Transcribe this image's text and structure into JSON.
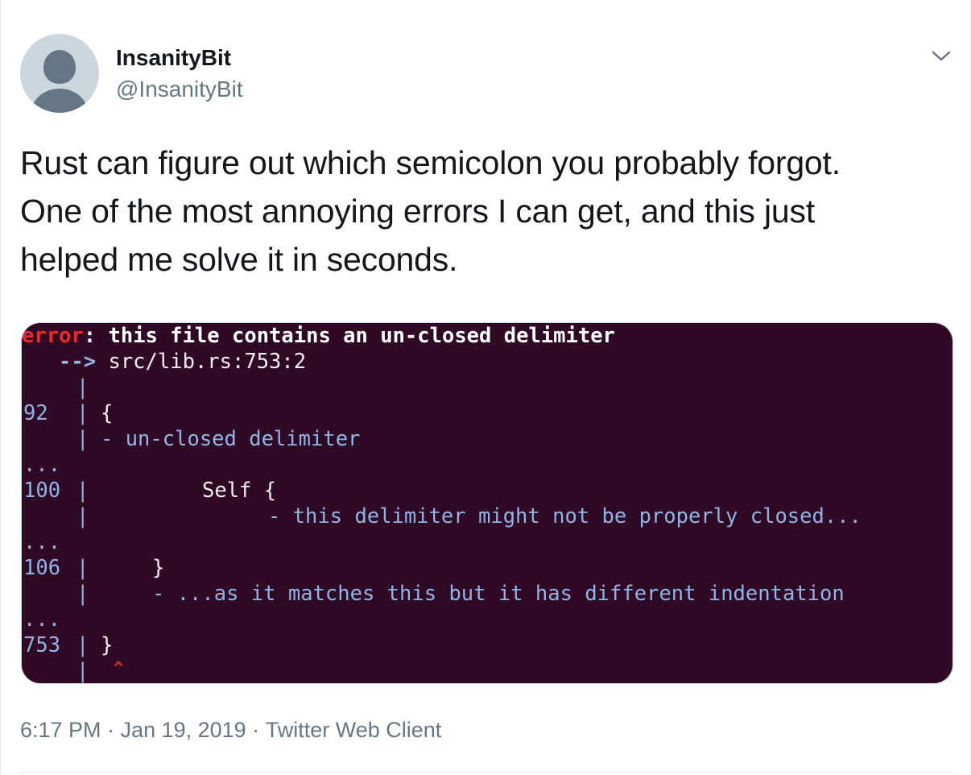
{
  "author": {
    "display_name": "InsanityBit",
    "handle": "@InsanityBit",
    "avatar_icon": "default-profile-icon"
  },
  "menu": {
    "caret_icon": "chevron-down-icon"
  },
  "tweet": {
    "lines": [
      "Rust can figure out which semicolon you probably forgot.",
      "One of the most annoying errors I can get, and this just",
      "helped me solve it in seconds."
    ]
  },
  "terminal": {
    "background": "#300a24",
    "error_color": "#ef2929",
    "note_color": "#8fb4e8",
    "error_label": "error",
    "error_message": ": this file contains an un-closed delimiter",
    "arrow": "   -->",
    "location": " src/lib.rs:753:2",
    "pipe": "|",
    "gutter_92": "92",
    "code_92": "{",
    "note_92": "- un-closed delimiter",
    "ellipsis": "...",
    "gutter_100": "100",
    "code_100": "Self {",
    "note_100": "- this delimiter might not be properly closed...",
    "gutter_106": "106",
    "code_106": "}",
    "note_106": "- ...as it matches this but it has different indentation",
    "gutter_753": "753",
    "code_753": "}",
    "caret": "^"
  },
  "footer": {
    "time": "6:17 PM",
    "separator": " · ",
    "date": "Jan 19, 2019",
    "client": "Twitter Web Client"
  }
}
